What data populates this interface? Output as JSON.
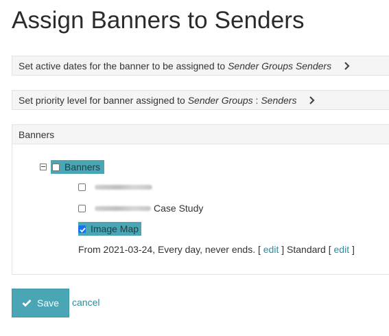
{
  "page": {
    "title": "Assign Banners to Senders"
  },
  "bars": {
    "dates": {
      "prefix": "Set active dates for the banner to be assigned to",
      "target": "Sender Groups Senders"
    },
    "priority": {
      "prefix": "Set priority level for banner assigned to",
      "target_group": "Sender Groups",
      "separator": ":",
      "target_sender": "Senders"
    }
  },
  "banners_panel": {
    "heading": "Banners",
    "root": {
      "label": "Banners",
      "checked": false,
      "expanded": true
    },
    "items": [
      {
        "label": "",
        "checked": false,
        "redacted": true
      },
      {
        "label": "Case Study",
        "checked": false,
        "redacted_prefix": true
      },
      {
        "label": "Image Map",
        "checked": true,
        "selected": true
      }
    ],
    "schedule": {
      "text": "From 2021-03-24, Every day, never ends. [",
      "edit_label": "edit",
      "close_bracket": "]",
      "priority_text": "Standard [",
      "priority_edit_label": "edit",
      "priority_close_bracket": "]"
    }
  },
  "actions": {
    "save_label": "Save",
    "cancel_label": "cancel"
  },
  "colors": {
    "accent": "#4aa6b4",
    "link": "#2a8ca0",
    "panel_bg": "#f5f5f5"
  },
  "icons": {
    "chevron": "chevron-right-icon",
    "save": "check-icon",
    "tree_toggle": "minus-box-icon"
  }
}
